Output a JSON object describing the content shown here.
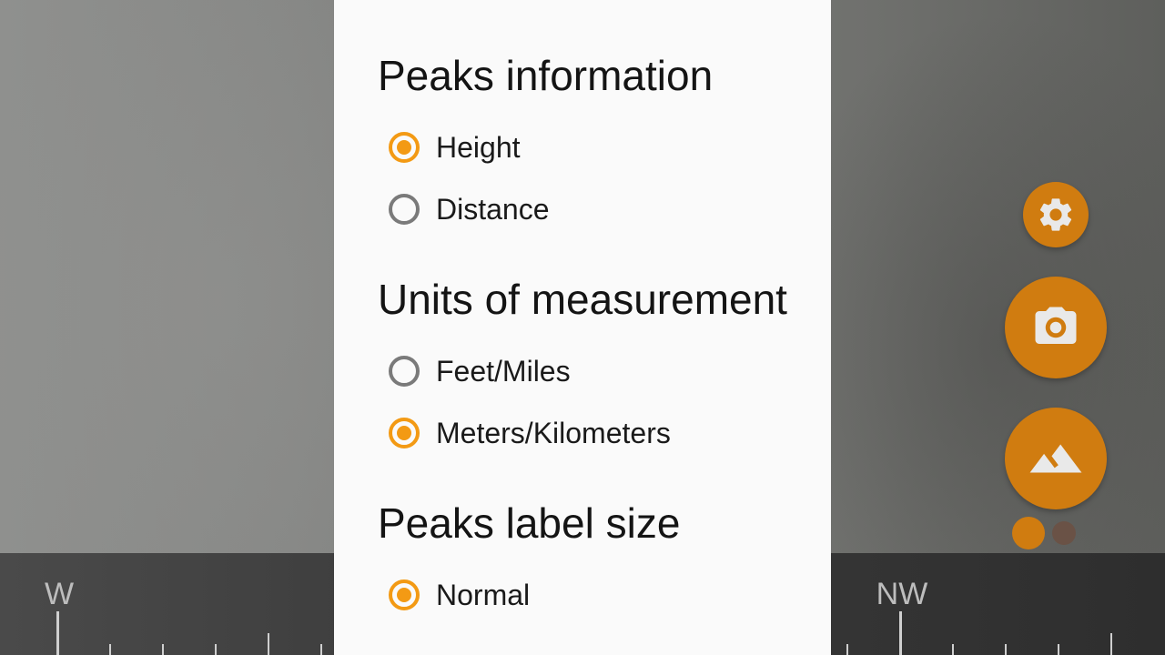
{
  "compass": {
    "labels": [
      {
        "id": "w",
        "text": "W"
      },
      {
        "id": "nw",
        "text": "NW"
      }
    ]
  },
  "dialog": {
    "sections": [
      {
        "title": "Peaks information",
        "options": [
          {
            "label": "Height",
            "checked": true
          },
          {
            "label": "Distance",
            "checked": false
          }
        ]
      },
      {
        "title": "Units of measurement",
        "options": [
          {
            "label": "Feet/Miles",
            "checked": false
          },
          {
            "label": "Meters/Kilometers",
            "checked": true
          }
        ]
      },
      {
        "title": "Peaks label size",
        "options": [
          {
            "label": "Normal",
            "checked": true
          }
        ]
      }
    ]
  },
  "fabs": {
    "settings_icon": "gear-icon",
    "camera_icon": "camera-icon",
    "peaks_icon": "mountain-icon"
  },
  "colors": {
    "accent": "#f39a14",
    "fab": "#d07c10",
    "radio_unchecked": "#7a7a7a",
    "dialog_bg": "#fafafa"
  }
}
